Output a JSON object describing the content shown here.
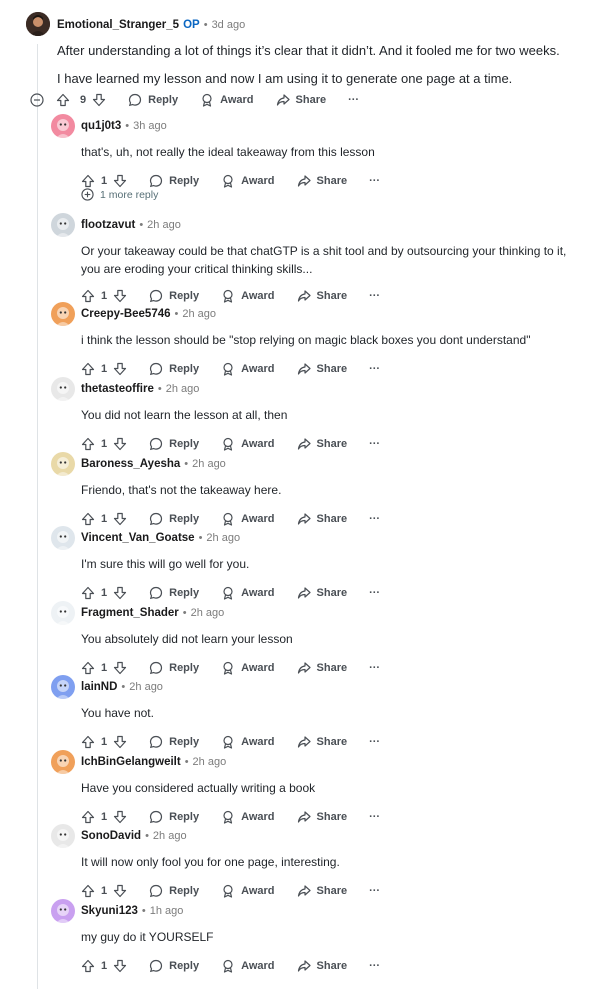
{
  "op": {
    "username": "Emotional_Stranger_5",
    "badge": "OP",
    "time": "3d ago",
    "paragraphs": [
      "After understanding a lot of things it’s clear that it didn’t. And it fooled me for two weeks.",
      "I have learned my lesson and now I am using it to generate one page at a time."
    ],
    "votes": "9"
  },
  "labels": {
    "reply": "Reply",
    "award": "Award",
    "share": "Share",
    "more": "···"
  },
  "more_replies": "1 more reply",
  "comments": [
    {
      "username": "qu1j0t3",
      "time": "3h ago",
      "text": "that's, uh, not really the ideal takeaway from this lesson",
      "votes": "1",
      "avatar_color": "#f28aa0"
    },
    {
      "username": "flootzavut",
      "time": "2h ago",
      "text": "Or your takeaway could be that chatGTP is a shit tool and by outsourcing your thinking to it, you are eroding your critical thinking skills...",
      "votes": "1",
      "avatar_color": "#cfd6dc"
    },
    {
      "username": "Creepy-Bee5746",
      "time": "2h ago",
      "text": "i think the lesson should be \"stop relying on magic black boxes you dont understand\"",
      "votes": "1",
      "avatar_color": "#f0a05a"
    },
    {
      "username": "thetasteoffire",
      "time": "2h ago",
      "text": "You did not learn the lesson at all, then",
      "votes": "1",
      "avatar_color": "#e8e8e8"
    },
    {
      "username": "Baroness_Ayesha",
      "time": "2h ago",
      "text": "Friendo, that's not the takeaway here.",
      "votes": "1",
      "avatar_color": "#e9d9a8"
    },
    {
      "username": "Vincent_Van_Goatse",
      "time": "2h ago",
      "text": "I'm sure this will go well for you.",
      "votes": "1",
      "avatar_color": "#dfe6ec"
    },
    {
      "username": "Fragment_Shader",
      "time": "2h ago",
      "text": "You absolutely did not learn your lesson",
      "votes": "1",
      "avatar_color": "#eef2f5"
    },
    {
      "username": "lainND",
      "time": "2h ago",
      "text": "You have not.",
      "votes": "1",
      "avatar_color": "#7f9ff0"
    },
    {
      "username": "IchBinGelangweilt",
      "time": "2h ago",
      "text": "Have you considered actually writing a book",
      "votes": "1",
      "avatar_color": "#f0a05a"
    },
    {
      "username": "SonoDavid",
      "time": "2h ago",
      "text": "It will now only fool you for one page, interesting.",
      "votes": "1",
      "avatar_color": "#e8e8e8"
    },
    {
      "username": "Skyuni123",
      "time": "1h ago",
      "text": "my guy do it YOURSELF",
      "votes": "1",
      "avatar_color": "#c9a0f0"
    }
  ]
}
